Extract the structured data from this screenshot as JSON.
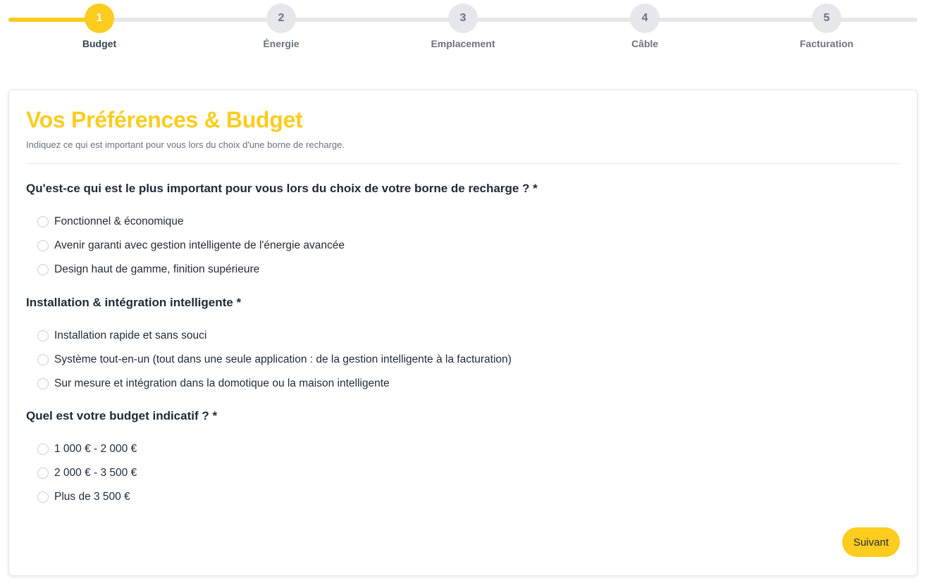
{
  "stepper": {
    "current_step": 1,
    "steps": [
      {
        "number": "1",
        "label": "Budget"
      },
      {
        "number": "2",
        "label": "Énergie"
      },
      {
        "number": "3",
        "label": "Emplacement"
      },
      {
        "number": "4",
        "label": "Câble"
      },
      {
        "number": "5",
        "label": "Facturation"
      }
    ]
  },
  "card": {
    "title": "Vos Préférences & Budget",
    "subtitle": "Indiquez ce qui est important pour vous lors du choix d'une borne de recharge.",
    "questions": [
      {
        "title": "Qu'est-ce qui est le plus important pour vous lors du choix de votre borne de recharge ? *",
        "options": [
          "Fonctionnel & économique",
          "Avenir garanti avec gestion intelligente de l'énergie avancée",
          "Design haut de gamme, finition supérieure"
        ]
      },
      {
        "title": "Installation & intégration intelligente *",
        "options": [
          "Installation rapide et sans souci",
          "Système tout-en-un (tout dans une seule application : de la gestion intelligente à la facturation)",
          "Sur mesure et intégration dans la domotique ou la maison intelligente"
        ]
      },
      {
        "title": "Quel est votre budget indicatif ? *",
        "options": [
          "1 000 € - 2 000 €",
          "2 000 € - 3 500 €",
          "Plus de 3 500 €"
        ]
      }
    ],
    "next_label": "Suivant"
  },
  "colors": {
    "accent": "#fccc1e",
    "track": "#e5e7eb",
    "text": "#1f2937",
    "muted": "#6b7280"
  }
}
